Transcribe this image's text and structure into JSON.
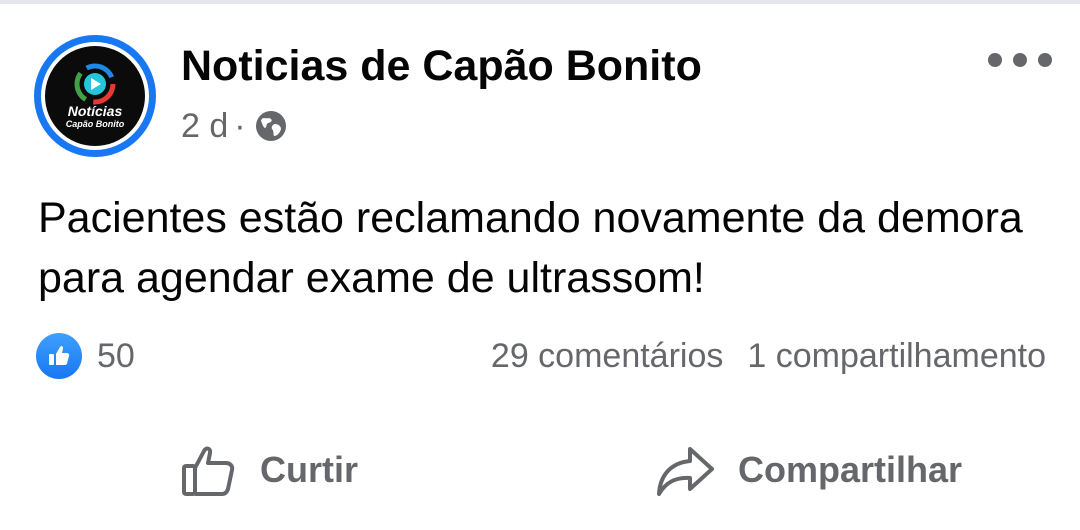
{
  "post": {
    "page_name": "Noticias de Capão Bonito",
    "time_ago": "2 d",
    "separator": "·",
    "privacy_icon": "globe-icon",
    "avatar": {
      "logo_line1": "Notícias",
      "logo_line2": "Capão Bonito"
    },
    "text": "Pacientes estão reclamando novamente da demora para agendar exame de ultrassom!",
    "reactions": {
      "icon": "like-icon",
      "count": "50"
    },
    "comments": "29 comentários",
    "shares": "1 compartilhamento"
  },
  "actions": {
    "like_label": "Curtir",
    "share_label": "Compartilhar"
  },
  "colors": {
    "facebook_blue": "#1877f2",
    "text_primary": "#050505",
    "text_secondary": "#65676b"
  }
}
